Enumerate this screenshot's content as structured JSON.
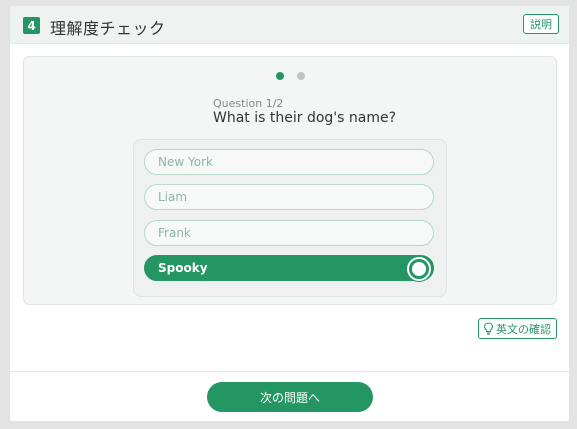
{
  "header": {
    "step_number": "4",
    "title": "理解度チェック",
    "explain_label": "説明"
  },
  "quiz": {
    "pagination": {
      "current": 1,
      "total": 2
    },
    "question_label": "Question 1/2",
    "question_text": "What is their dog's name?",
    "options": [
      {
        "label": "New York",
        "selected": false
      },
      {
        "label": "Liam",
        "selected": false
      },
      {
        "label": "Frank",
        "selected": false
      },
      {
        "label": "Spooky",
        "selected": true
      }
    ]
  },
  "confirm_english_label": "英文の確認",
  "next_button_label": "次の問題へ",
  "colors": {
    "accent": "#239663",
    "background": "#e3e3e3",
    "card": "#f4f6f5"
  },
  "icons": [
    "lightbulb-icon",
    "check-circle-icon"
  ]
}
